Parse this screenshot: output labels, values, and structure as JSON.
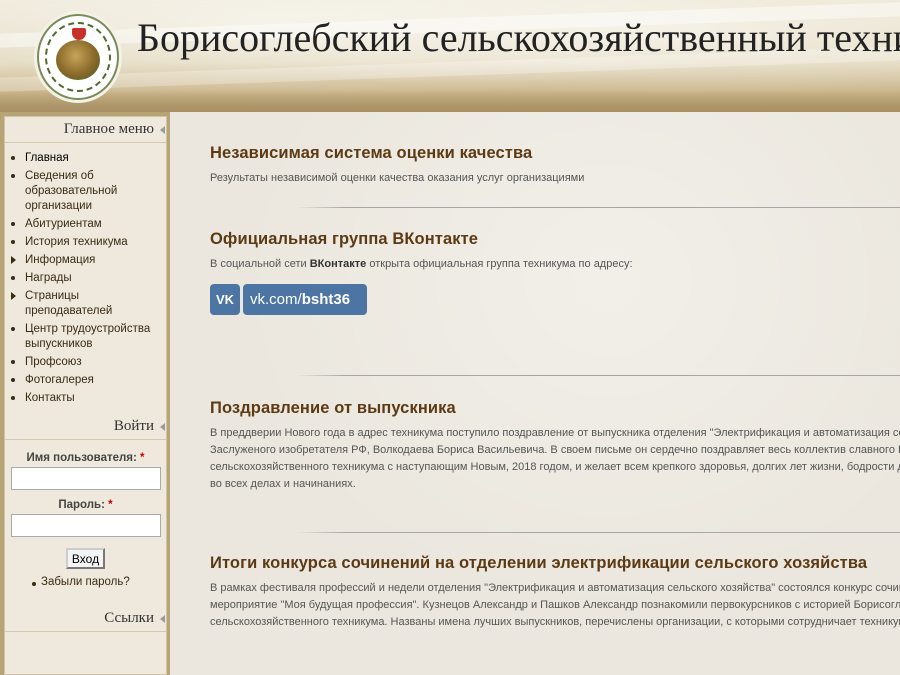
{
  "header": {
    "site_title": "Борисоглебский сельскохозяйственный техникум"
  },
  "sidebar": {
    "main_menu_title": "Главное меню",
    "menu_items": [
      {
        "label": "Главная"
      },
      {
        "label": "Сведения об образовательной организации"
      },
      {
        "label": "Абитуриентам"
      },
      {
        "label": "История техникума"
      },
      {
        "label": "Информация"
      },
      {
        "label": "Награды"
      },
      {
        "label": "Страницы преподавателей"
      },
      {
        "label": "Центр трудоустройства выпускников"
      },
      {
        "label": "Профсоюз"
      },
      {
        "label": "Фотогалерея"
      },
      {
        "label": "Контакты"
      }
    ],
    "login": {
      "title": "Войти",
      "username_label": "Имя пользователя:",
      "password_label": "Пароль:",
      "required_mark": "*",
      "submit_label": "Вход",
      "forgot_label": "Забыли пароль?"
    },
    "links_title": "Ссылки"
  },
  "articles": [
    {
      "title": "Независимая система оценки качества",
      "text": "Результаты независимой оценки качества оказания услуг организациями"
    },
    {
      "title": "Официальная группа ВКонтакте",
      "text_before": "В социальной сети ",
      "text_bold": "ВКонтакте",
      "text_after": " открыта официальная группа техникума по адресу:",
      "vk_logo": "VK",
      "vk_domain": "vk.com/",
      "vk_handle": "bsht36"
    },
    {
      "title": "Поздравление от выпускника",
      "lines": [
        "В преддверии Нового года в адрес техникума поступило поздравление от выпускника отделения \"Электрификация и автоматизация сельского хозяйства\"",
        "Заслуженого изобретателя РФ, Волкодаева Бориса Васильевича. В своем письме он сердечно поздравляет весь  коллектив славного Борисоглебского",
        "сельскохозяйственного техникума с наступающим Новым, 2018 годом, и желает всем крепкого здоровья, долгих лет жизни, бодрости духа и успехов",
        "во всех делах и начинаниях."
      ]
    },
    {
      "title": "Итоги конкурса сочинений на отделении электрификации сельского хозяйства",
      "lines": [
        "В рамках фестиваля профессий и недели отделения \"Электрификация и автоматизация сельского хозяйства\" состоялся конкурс сочинений и",
        "мероприятие \"Моя  будущая профессия\". Кузнецов Александр и Пашков Александр познакомили первокурсников с историей Борисоглебского",
        "сельскохозяйственного техникума. Названы имена лучших выпускников, перечислены организации, с которыми сотрудничает техникум."
      ]
    }
  ]
}
